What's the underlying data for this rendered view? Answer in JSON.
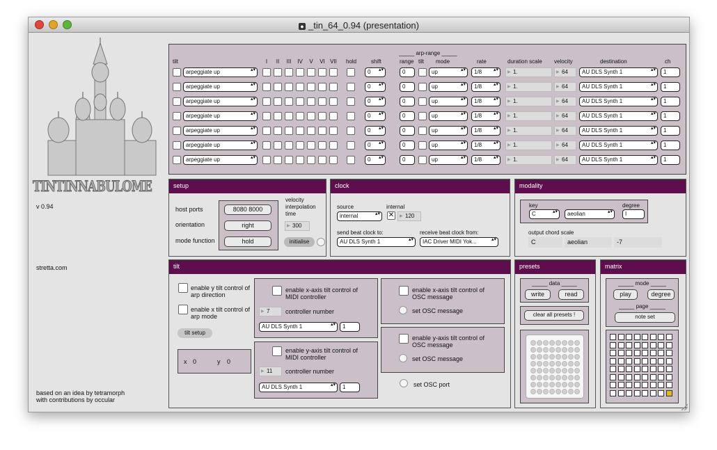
{
  "window": {
    "title": "_tin_64_0.94 (presentation)"
  },
  "sidebar": {
    "logo_text": "TINTINNABULOME",
    "version": "v 0.94",
    "website": "stretta.com",
    "credits_line1": "based on an idea by tetramorph",
    "credits_line2": "with contributions by occular"
  },
  "arp": {
    "headers": {
      "tilt": "tilt",
      "degrees": [
        "I",
        "II",
        "III",
        "IV",
        "V",
        "VI",
        "VII"
      ],
      "hold": "hold",
      "shift": "shift",
      "arp_range": "_____ arp-range _____",
      "range": "range",
      "tilt2": "tilt",
      "mode": "mode",
      "rate": "rate",
      "duration_scale": "duration scale",
      "velocity": "velocity",
      "destination": "destination",
      "ch": "ch"
    },
    "rows": [
      {
        "pattern": "arpeggiate up",
        "shift": "0",
        "range": "0",
        "mode": "up",
        "rate": "1/8",
        "duration": "1.",
        "velocity": "64",
        "destination": "AU DLS Synth 1",
        "ch": "1"
      },
      {
        "pattern": "arpeggiate up",
        "shift": "0",
        "range": "0",
        "mode": "up",
        "rate": "1/8",
        "duration": "1.",
        "velocity": "64",
        "destination": "AU DLS Synth 1",
        "ch": "1"
      },
      {
        "pattern": "arpeggiate up",
        "shift": "0",
        "range": "0",
        "mode": "up",
        "rate": "1/8",
        "duration": "1.",
        "velocity": "64",
        "destination": "AU DLS Synth 1",
        "ch": "1"
      },
      {
        "pattern": "arpeggiate up",
        "shift": "0",
        "range": "0",
        "mode": "up",
        "rate": "1/8",
        "duration": "1.",
        "velocity": "64",
        "destination": "AU DLS Synth 1",
        "ch": "1"
      },
      {
        "pattern": "arpeggiate up",
        "shift": "0",
        "range": "0",
        "mode": "up",
        "rate": "1/8",
        "duration": "1.",
        "velocity": "64",
        "destination": "AU DLS Synth 1",
        "ch": "1"
      },
      {
        "pattern": "arpeggiate up",
        "shift": "0",
        "range": "0",
        "mode": "up",
        "rate": "1/8",
        "duration": "1.",
        "velocity": "64",
        "destination": "AU DLS Synth 1",
        "ch": "1"
      },
      {
        "pattern": "arpeggiate up",
        "shift": "0",
        "range": "0",
        "mode": "up",
        "rate": "1/8",
        "duration": "1.",
        "velocity": "64",
        "destination": "AU DLS Synth 1",
        "ch": "1"
      }
    ]
  },
  "setup": {
    "title": "setup",
    "host_ports_label": "host ports",
    "host_ports_value": "8080 8000",
    "orientation_label": "orientation",
    "orientation_value": "right",
    "mode_function_label": "mode function",
    "mode_function_value": "hold",
    "velocity_label": "velocity interpolation time",
    "velocity_value": "300",
    "initialise": "initialise"
  },
  "clock": {
    "title": "clock",
    "source_label": "source",
    "source_value": "internal",
    "internal_label": "internal",
    "internal_value": "120",
    "send_label": "send beat clock to:",
    "send_value": "AU DLS Synth 1",
    "receive_label": "receive beat clock from:",
    "receive_value": "IAC Driver MIDI Yok..."
  },
  "modality": {
    "title": "modality",
    "key_label": "key",
    "key_value": "C",
    "scale_value": "aeolian",
    "degree_label": "degree",
    "degree_value": "I",
    "output_label": "output chord scale",
    "output_values": [
      "C",
      "aeolian",
      "-7"
    ]
  },
  "tilt": {
    "title": "tilt",
    "y_tilt_label": "enable y tilt control of arp direction",
    "x_tilt_label": "enable x tilt control of arp mode",
    "tilt_setup": "tilt setup",
    "x_label": "x",
    "x_value": "0",
    "y_label": "y",
    "y_value": "0",
    "x_midi_label": "enable x-axis tilt control of MIDI controller",
    "x_cc_value": "7",
    "controller_number": "controller number",
    "x_dest": "AU DLS Synth 1",
    "x_ch": "1",
    "y_midi_label": "enable y-axis tilt control of MIDI controller",
    "y_cc_value": "11",
    "y_dest": "AU DLS Synth 1",
    "y_ch": "1",
    "x_osc_label": "enable x-axis tilt control of OSC message",
    "set_osc": "set OSC message",
    "y_osc_label": "enable y-axis tilt control of OSC message",
    "set_osc_port": "set OSC port"
  },
  "presets": {
    "title": "presets",
    "data_label": "_____ data _____",
    "write": "write",
    "read": "read",
    "clear": "clear all presets !"
  },
  "matrix": {
    "title": "matrix",
    "mode_label": "_____ mode _____",
    "play": "play",
    "degree": "degree",
    "page_label": "_____ page _____",
    "note_set": "note set",
    "active_cell": "row 8 col 8"
  },
  "colors": {
    "header": "#5e0e4c",
    "subpanel": "#cbc0c9",
    "accent": "#e6b820"
  }
}
